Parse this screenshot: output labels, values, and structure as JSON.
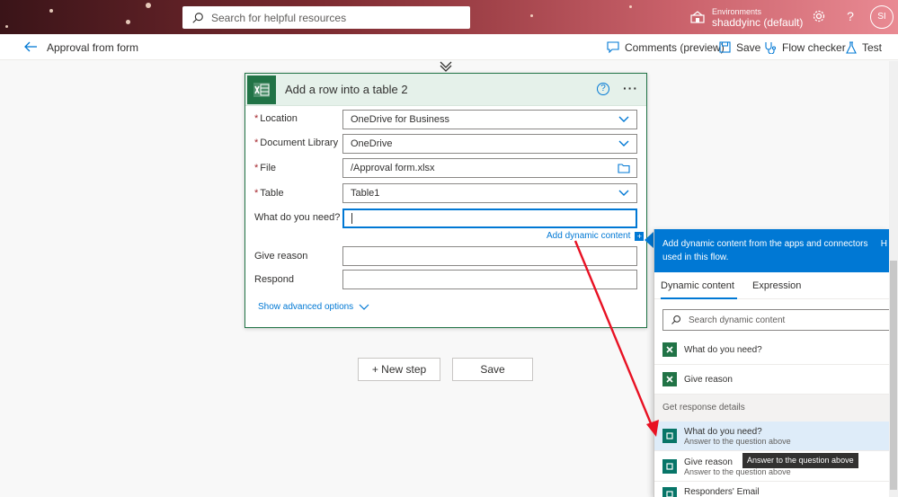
{
  "header": {
    "search_placeholder": "Search for helpful resources",
    "env_label": "Environments",
    "env_name": "shaddyinc (default)",
    "settings_icon": "gear-icon",
    "help_icon": "question-icon",
    "avatar_initials": "SI"
  },
  "commandbar": {
    "flow_name": "Approval from form",
    "comments_label": "Comments (preview)",
    "save_label": "Save",
    "checker_label": "Flow checker",
    "test_label": "Test"
  },
  "card": {
    "title": "Add a row into a table 2",
    "fields": {
      "location_label": "Location",
      "location_value": "OneDrive for Business",
      "doclib_label": "Document Library",
      "doclib_value": "OneDrive",
      "file_label": "File",
      "file_value": "/Approval form.xlsx",
      "table_label": "Table",
      "table_value": "Table1",
      "need_label": "What do you need?",
      "reason_label": "Give reason",
      "respond_label": "Respond"
    },
    "add_dynamic": "Add dynamic content",
    "advanced": "Show advanced options"
  },
  "buttons": {
    "new_step": "+ New step",
    "save": "Save"
  },
  "dynamic_panel": {
    "header_text": "Add dynamic content from the apps and connectors used in this flow.",
    "hide_label": "H",
    "tab_dynamic": "Dynamic content",
    "tab_expression": "Expression",
    "search_placeholder": "Search dynamic content",
    "items_top": [
      {
        "title": "What do you need?"
      },
      {
        "title": "Give reason"
      }
    ],
    "section_title": "Get response details",
    "items_response": [
      {
        "title": "What do you need?",
        "subtitle": "Answer to the question above"
      },
      {
        "title": "Give reason",
        "subtitle": "Answer to the question above"
      },
      {
        "title": "Responders' Email"
      }
    ],
    "tooltip": "Answer to the question above"
  },
  "colors": {
    "accent": "#0078d4",
    "excel": "#217346",
    "annotation_arrow": "#e81123"
  }
}
